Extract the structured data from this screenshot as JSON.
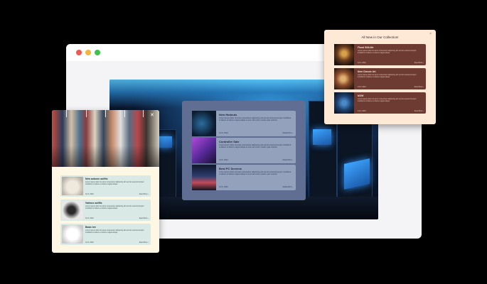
{
  "browser": {
    "traffic_lights": {
      "close": "#ee5a52",
      "minimize": "#f5b43a",
      "maximize": "#3fc24a"
    }
  },
  "hero": {
    "image": "arcade-machines-photo"
  },
  "center_panel": {
    "background": "#5f6e92",
    "items": [
      {
        "title": "New Hadouts",
        "text": "Lorem ipsum dolor sit amet consectetur adipiscing elit sed do eiusmod tempor incididunt ut labore et dolore magna aliqua ut enim ad minim veniam quis nostrud",
        "meta": "Jul 6, 2022",
        "more": "Read More ›",
        "thumb": "circuit-board-image"
      },
      {
        "title": "Controller Sale",
        "text": "Lorem ipsum dolor sit amet consectetur adipiscing elit sed do eiusmod tempor incididunt ut labore et dolore magna aliqua ut enim ad minim veniam quis nostrud",
        "meta": "Jul 6, 2022",
        "more": "Read More ›",
        "thumb": "gaming-keyboard-image"
      },
      {
        "title": "Best PC Screens",
        "text": "Lorem ipsum dolor sit amet consectetur adipiscing elit sed do eiusmod tempor incididunt ut labore et dolore magna aliqua ut enim ad minim veniam quis nostrud",
        "meta": "Jul 6, 2022",
        "more": "Read More ›",
        "thumb": "pc-screens-image"
      }
    ]
  },
  "left_popup": {
    "background": "#fdf7e4",
    "items": [
      {
        "title": "New autumn outfits",
        "text": "Lorem ipsum dolor sit amet consectetur adipiscing elit sed do eiusmod tempor incididunt ut labore et dolore magna aliqua",
        "meta": "Jul 6, 2022",
        "more": "Read More ›",
        "thumb": "sweater-image"
      },
      {
        "title": "Various outfits",
        "text": "Lorem ipsum dolor sit amet consectetur adipiscing elit sed do eiusmod tempor incididunt ut labore et dolore magna aliqua",
        "meta": "Jul 6, 2022",
        "more": "Read More ›",
        "thumb": "outfit-flatlay-image"
      },
      {
        "title": "Basic tee",
        "text": "Lorem ipsum dolor sit amet consectetur adipiscing elit sed do eiusmod tempor incididunt ut labore et dolore magna aliqua",
        "meta": "Jul 6, 2022",
        "more": "Read More ›",
        "thumb": "white-tshirt-image"
      }
    ]
  },
  "right_popup": {
    "title": "All New in Our Collection!",
    "close_label": "×",
    "items": [
      {
        "title": "Floral Still-life",
        "text": "Lorem ipsum dolor sit amet consectetur adipiscing elit sed do eiusmod tempor incididunt ut labore et dolore magna aliqua",
        "meta": "Jul 6, 2022",
        "more": "Read More ›",
        "thumb": "floral-painting-image"
      },
      {
        "title": "New Classic Art",
        "text": "Lorem ipsum dolor sit amet consectetur adipiscing elit sed do eiusmod tempor incididunt ut labore et dolore magna aliqua",
        "meta": "Jul 6, 2022",
        "more": "Read More ›",
        "thumb": "classic-painting-image"
      },
      {
        "title": "NOW",
        "text": "Lorem ipsum dolor sit amet consectetur adipiscing elit sed do eiusmod tempor incididunt ut labore et dolore magna aliqua",
        "meta": "Jul 6, 2022",
        "more": "Read More ›",
        "thumb": "blue-painting-image"
      }
    ]
  }
}
